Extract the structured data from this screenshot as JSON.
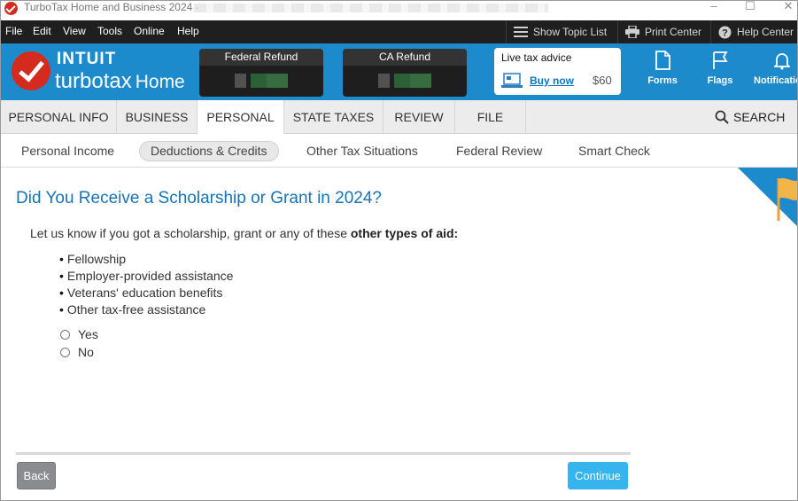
{
  "window": {
    "title": "TurboTax Home and Business 2024 -",
    "minimize": "–",
    "maximize": "☐",
    "close": "✕"
  },
  "menu": {
    "items": [
      "File",
      "Edit",
      "View",
      "Tools",
      "Online",
      "Help"
    ],
    "show_topic_list": "Show Topic List",
    "print_center": "Print Center",
    "help_center": "Help Center"
  },
  "brand": {
    "intuit": "INTUIT",
    "turbotax": "turbotax",
    "edition": "Home",
    "accent": "#1d8acb",
    "logo_red": "#d52b1e"
  },
  "refunds": {
    "federal_label": "Federal Refund",
    "ca_label": "CA Refund"
  },
  "live_advice": {
    "title": "Live tax advice",
    "buy_now": "Buy now",
    "price": "$60"
  },
  "toolbar": {
    "forms": "Forms",
    "flags": "Flags",
    "notifications": "Notifications"
  },
  "tabs": {
    "items": [
      "PERSONAL INFO",
      "BUSINESS",
      "PERSONAL",
      "STATE TAXES",
      "REVIEW",
      "FILE"
    ],
    "active": "PERSONAL",
    "search": "SEARCH"
  },
  "subtabs": {
    "items": [
      "Personal Income",
      "Deductions & Credits",
      "Other Tax Situations",
      "Federal Review",
      "Smart Check"
    ],
    "active": "Deductions & Credits"
  },
  "page": {
    "heading": "Did You Receive a Scholarship or Grant in 2024?",
    "intro_text": "Let us know if you got a scholarship, grant or any of these ",
    "intro_bold": "other types of aid:",
    "bullets": [
      "Fellowship",
      "Employer-provided assistance",
      "Veterans' education benefits",
      "Other tax-free assistance"
    ],
    "options": [
      "Yes",
      "No"
    ],
    "heading_color": "#1773b8"
  },
  "nav": {
    "back": "Back",
    "continue": "Continue",
    "continue_color": "#35b4ee"
  }
}
